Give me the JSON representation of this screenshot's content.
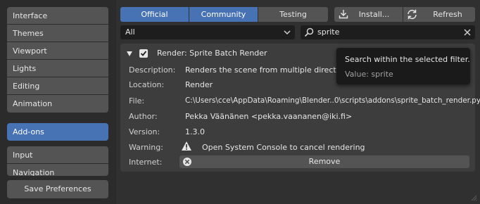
{
  "sidebar": {
    "group1": [
      {
        "label": "Interface"
      },
      {
        "label": "Themes"
      },
      {
        "label": "Viewport"
      },
      {
        "label": "Lights"
      },
      {
        "label": "Editing"
      },
      {
        "label": "Animation"
      }
    ],
    "addons_label": "Add-ons",
    "group2": [
      {
        "label": "Input"
      },
      {
        "label": "Navigation"
      }
    ],
    "save_label": "Save Preferences"
  },
  "toolbar": {
    "tabs": [
      {
        "label": "Official",
        "active": true
      },
      {
        "label": "Community",
        "active": true
      },
      {
        "label": "Testing",
        "active": false
      }
    ],
    "install_label": "Install...",
    "refresh_label": "Refresh"
  },
  "filter": {
    "category_value": "All",
    "search_value": "sprite"
  },
  "addon": {
    "title": "Render: Sprite Batch Render",
    "rows": [
      {
        "label": "Description:",
        "value": "Renders the scene from multiple directions."
      },
      {
        "label": "Location:",
        "value": "Render"
      },
      {
        "label": "File:",
        "value": "C:\\Users\\cce\\AppData\\Roaming\\Blender..0\\scripts\\addons\\sprite_batch_render.py"
      },
      {
        "label": "Author:",
        "value": "Pekka Väänänen <pekka.vaananen@iki.fi>"
      },
      {
        "label": "Version:",
        "value": "1.3.0"
      }
    ],
    "warning_label": "Warning:",
    "warning_text": "Open System Console to cancel rendering",
    "internet_label": "Internet:",
    "remove_label": "Remove"
  },
  "tooltip": {
    "title": "Search within the selected filter.",
    "value": "Value: sprite"
  },
  "colors": {
    "accent": "#4772b3",
    "button": "#545454",
    "background": "#303030"
  }
}
